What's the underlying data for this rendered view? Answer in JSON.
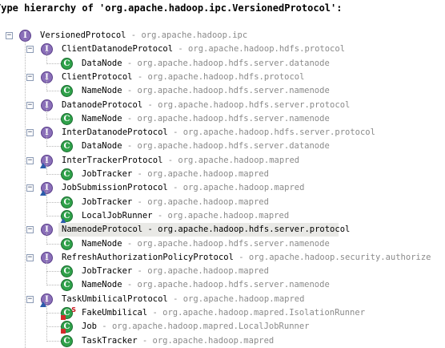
{
  "header": {
    "title": "Type hierarchy of 'org.apache.hadoop.ipc.VersionedProtocol':"
  },
  "tree": {
    "rows": [
      {
        "name": "VersionedProtocol",
        "pkg": "org.apache.hadoop.ipc",
        "icon": "interface-icon"
      },
      {
        "name": "ClientDatanodeProtocol",
        "pkg": "org.apache.hadoop.hdfs.protocol",
        "icon": "interface-icon"
      },
      {
        "name": "DataNode",
        "pkg": "org.apache.hadoop.hdfs.server.datanode",
        "icon": "class-icon"
      },
      {
        "name": "ClientProtocol",
        "pkg": "org.apache.hadoop.hdfs.protocol",
        "icon": "interface-icon"
      },
      {
        "name": "NameNode",
        "pkg": "org.apache.hadoop.hdfs.server.namenode",
        "icon": "class-icon"
      },
      {
        "name": "DatanodeProtocol",
        "pkg": "org.apache.hadoop.hdfs.server.protocol",
        "icon": "interface-icon"
      },
      {
        "name": "NameNode",
        "pkg": "org.apache.hadoop.hdfs.server.namenode",
        "icon": "class-icon"
      },
      {
        "name": "InterDatanodeProtocol",
        "pkg": "org.apache.hadoop.hdfs.server.protocol",
        "icon": "interface-icon"
      },
      {
        "name": "DataNode",
        "pkg": "org.apache.hadoop.hdfs.server.datanode",
        "icon": "class-icon"
      },
      {
        "name": "InterTrackerProtocol",
        "pkg": "org.apache.hadoop.mapred",
        "icon": "interface-warning-icon"
      },
      {
        "name": "JobTracker",
        "pkg": "org.apache.hadoop.mapred",
        "icon": "class-icon"
      },
      {
        "name": "JobSubmissionProtocol",
        "pkg": "org.apache.hadoop.mapred",
        "icon": "interface-warning-icon"
      },
      {
        "name": "JobTracker",
        "pkg": "org.apache.hadoop.mapred",
        "icon": "class-icon"
      },
      {
        "name": "LocalJobRunner",
        "pkg": "org.apache.hadoop.mapred",
        "icon": "class-warning-icon"
      },
      {
        "name": "NamenodeProtocol",
        "pkg": "org.apache.hadoop.hdfs.server.protocol",
        "icon": "interface-icon"
      },
      {
        "name": "NameNode",
        "pkg": "org.apache.hadoop.hdfs.server.namenode",
        "icon": "class-icon"
      },
      {
        "name": "RefreshAuthorizationPolicyProtocol",
        "pkg": "org.apache.hadoop.security.authorize",
        "icon": "interface-icon"
      },
      {
        "name": "JobTracker",
        "pkg": "org.apache.hadoop.mapred",
        "icon": "class-icon"
      },
      {
        "name": "NameNode",
        "pkg": "org.apache.hadoop.hdfs.server.namenode",
        "icon": "class-icon"
      },
      {
        "name": "TaskUmbilicalProtocol",
        "pkg": "org.apache.hadoop.mapred",
        "icon": "interface-warning-icon"
      },
      {
        "name": "FakeUmbilical",
        "pkg": "org.apache.hadoop.mapred.IsolationRunner",
        "icon": "class-private-static-icon"
      },
      {
        "name": "Job",
        "pkg": "org.apache.hadoop.mapred.LocalJobRunner",
        "icon": "class-private-icon"
      },
      {
        "name": "TaskTracker",
        "pkg": "org.apache.hadoop.mapred",
        "icon": "class-icon"
      }
    ],
    "selected_index": 14,
    "separator": " - ",
    "interface_glyph": "I",
    "class_glyph": "C",
    "static_glyph": "S"
  }
}
